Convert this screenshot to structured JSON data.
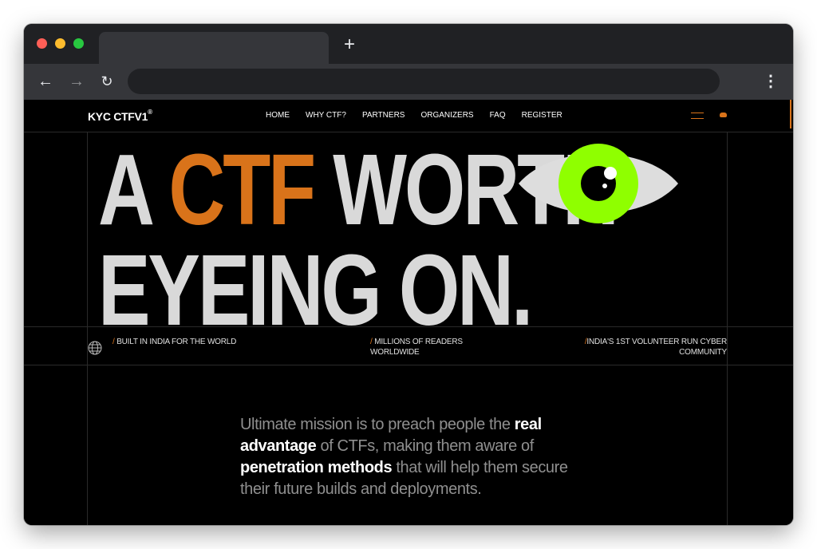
{
  "browser": {
    "new_tab_label": "+",
    "back_label": "←",
    "forward_label": "→",
    "reload_label": "↻",
    "menu_label": "⋮"
  },
  "site": {
    "logo": "KYC CTFV1",
    "logo_mark": "®",
    "nav": [
      "HOME",
      "WHY CTF?",
      "PARTNERS",
      "ORGANIZERS",
      "FAQ",
      "REGISTER"
    ]
  },
  "hero": {
    "line1_prefix": "A ",
    "line1_accent": "CTF",
    "line1_suffix": " WORTH",
    "line2": "EYEING ON."
  },
  "stats": [
    {
      "slash": "/",
      "text": "BUILT IN INDIA FOR THE WORLD"
    },
    {
      "slash": "/",
      "text": "MILLIONS OF READERS WORLDWIDE"
    },
    {
      "slash": "/",
      "text": "INDIA'S 1ST VOLUNTEER RUN CYBER COMMUNITY"
    }
  ],
  "mission": {
    "p1": "Ultimate mission is to preach people the ",
    "b1": "real advantage",
    "p2": " of CTFs, making them aware of ",
    "b2": "penetration methods",
    "p3": " that will help them secure their future builds and deployments."
  },
  "colors": {
    "accent": "#d9731a",
    "eye_iris": "#8fff00",
    "hero_text": "#d9d9d9",
    "background": "#000000"
  },
  "icons": [
    "globe-icon",
    "menu-icon",
    "discord-icon",
    "eye-illustration"
  ]
}
